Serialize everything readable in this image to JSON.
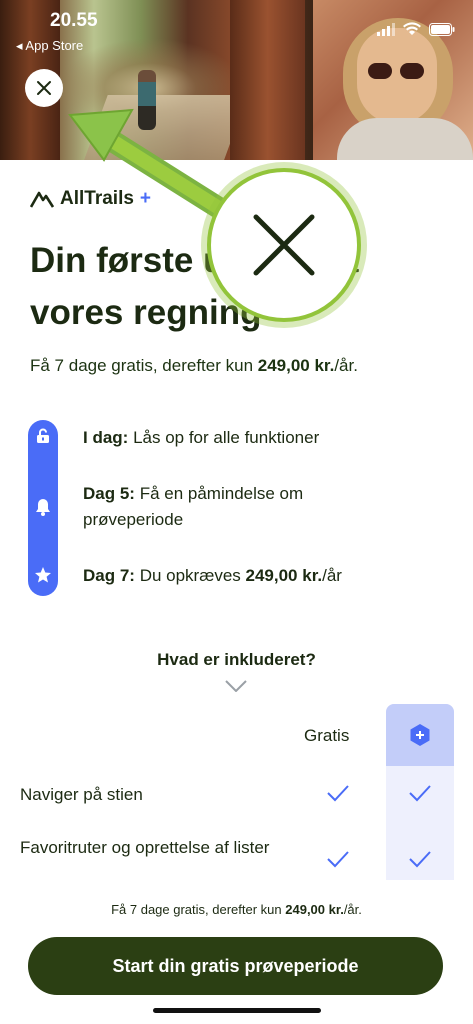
{
  "status_bar": {
    "time": "20.55",
    "back_label": "◂ App Store"
  },
  "brand": {
    "name": "AllTrails",
    "plus": "+",
    "accent_color": "#4a6cf7",
    "dark_green": "#2b3f13",
    "highlight_green": "#92c43a"
  },
  "headline": "Din første uge er på vores regning",
  "subtitle": {
    "prefix": "Få 7 dage gratis, derefter kun ",
    "price": "249,00 kr.",
    "suffix": "/år."
  },
  "timeline": [
    {
      "icon": "lock-open-icon",
      "bold": "I dag:",
      "text": " Lås op for alle funktioner"
    },
    {
      "icon": "bell-icon",
      "bold": "Dag 5:",
      "text": " Få en påmindelse om prøveperiode"
    },
    {
      "icon": "star-icon",
      "bold": "Dag 7:",
      "text": " Du opkræves ",
      "price": "249,00 kr.",
      "suffix": "/år"
    }
  ],
  "included_label": "Hvad er inkluderet?",
  "comparison": {
    "free_col": "Gratis",
    "plus_col_icon": "plus-badge-icon",
    "features": [
      {
        "label": "Naviger på stien",
        "free": true,
        "plus": true
      },
      {
        "label": "Favoritruter og oprettelse af lister",
        "free": true,
        "plus": true
      }
    ]
  },
  "footer": {
    "prefix": "Få 7 dage gratis, derefter kun ",
    "price": "249,00 kr.",
    "suffix": "/år."
  },
  "cta_label": "Start din gratis prøveperiode"
}
